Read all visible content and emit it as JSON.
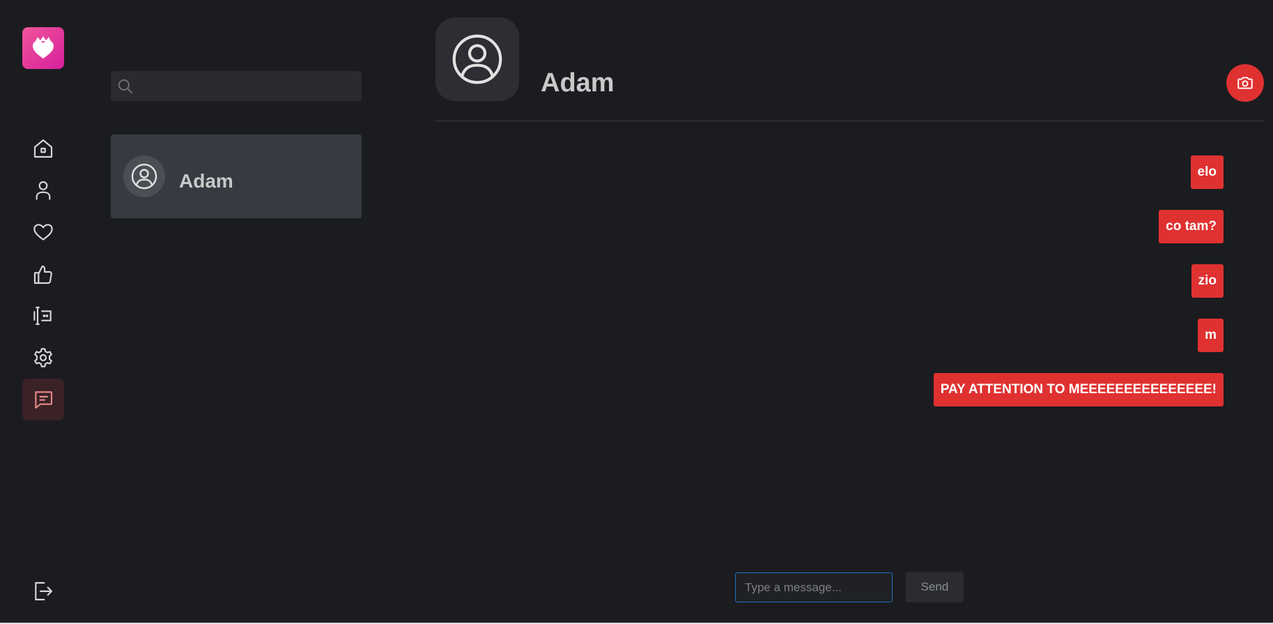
{
  "nav": {
    "logo": "heart-crown-logo",
    "items": [
      {
        "icon": "home-icon",
        "active": false
      },
      {
        "icon": "user-icon",
        "active": false
      },
      {
        "icon": "heart-icon",
        "active": false
      },
      {
        "icon": "thumbs-up-icon",
        "active": false
      },
      {
        "icon": "text-cursor-icon",
        "active": false
      },
      {
        "icon": "settings-icon",
        "active": false
      },
      {
        "icon": "chat-icon",
        "active": true
      }
    ],
    "logout_icon": "logout-icon"
  },
  "search": {
    "value": "",
    "placeholder": "",
    "icon": "search-icon"
  },
  "contacts": [
    {
      "name": "Adam",
      "avatar_icon": "user-circle-icon",
      "selected": true
    }
  ],
  "chat": {
    "name": "Adam",
    "avatar_icon": "user-circle-icon",
    "camera_icon": "camera-icon",
    "messages": [
      {
        "text": "elo",
        "outgoing": true
      },
      {
        "text": "co tam?",
        "outgoing": true
      },
      {
        "text": "zio",
        "outgoing": true
      },
      {
        "text": "m",
        "outgoing": true
      },
      {
        "text": "PAY ATTENTION TO MEEEEEEEEEEEEEEE!",
        "outgoing": true
      }
    ]
  },
  "composer": {
    "value": "",
    "placeholder": "Type a message...",
    "send_label": "Send"
  },
  "colors": {
    "background": "#1b1c20",
    "accent": "#e03131",
    "logo_gradient_start": "#f0559a",
    "logo_gradient_end": "#d61f9c",
    "selected_contact": "#363b42",
    "active_nav": "#3a2226",
    "input_focus": "#1f6fbf"
  }
}
